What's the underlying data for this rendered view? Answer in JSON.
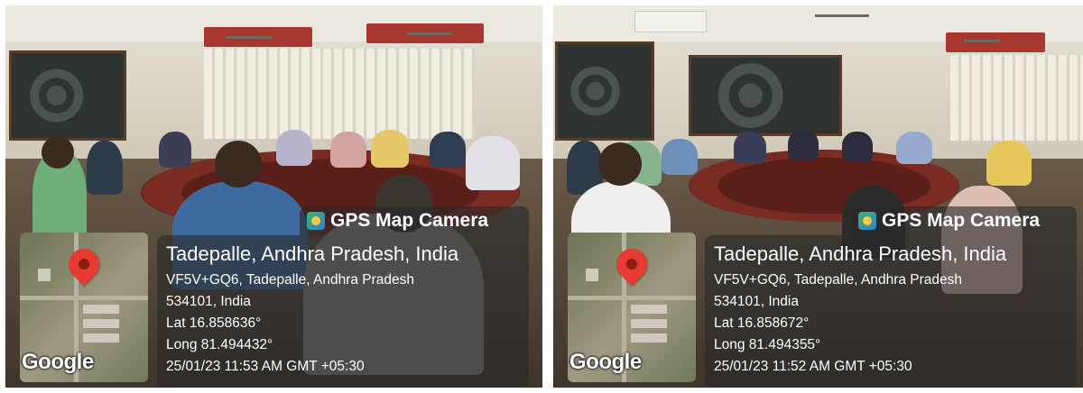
{
  "photos": [
    {
      "app_tag": "GPS Map Camera",
      "address_title": "Tadepalle, Andhra Pradesh, India",
      "address_line1": "VF5V+GQ6, Tadepalle, Andhra Pradesh",
      "address_line2": "534101, India",
      "lat": "Lat 16.858636°",
      "long": "Long 81.494432°",
      "datetime": "25/01/23 11:53 AM GMT +05:30",
      "map_brand": "Google"
    },
    {
      "app_tag": "GPS Map Camera",
      "address_title": "Tadepalle, Andhra Pradesh, India",
      "address_line1": "VF5V+GQ6, Tadepalle, Andhra Pradesh",
      "address_line2": "534101, India",
      "lat": "Lat 16.858672°",
      "long": "Long 81.494355°",
      "datetime": "25/01/23 11:52 AM GMT +05:30",
      "map_brand": "Google"
    }
  ],
  "colors": {
    "pin": "#e53b30",
    "overlay": "rgba(40,40,40,0.62)",
    "table": "#5a1f18"
  },
  "icons": {
    "app": "camera-map-icon",
    "pin": "map-pin-icon"
  }
}
